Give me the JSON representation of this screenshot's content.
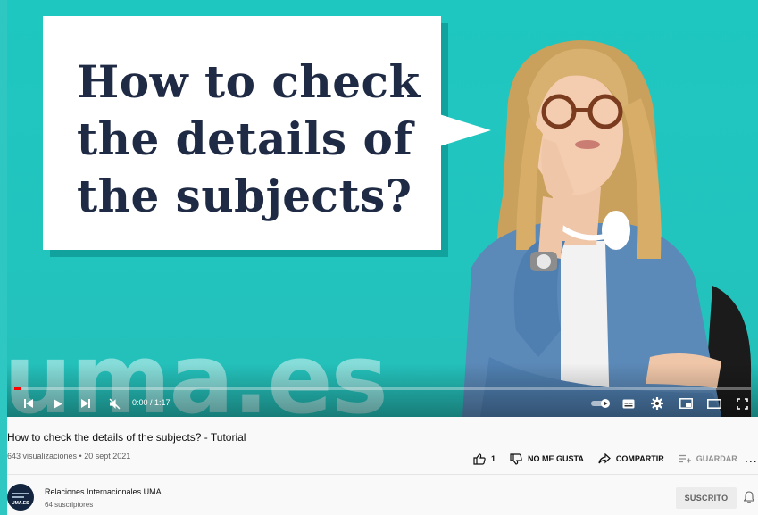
{
  "video": {
    "title_card_lines": [
      "How to check",
      "the details of",
      "the subjects?"
    ],
    "watermark": "uma.es",
    "time_display": "0:00 / 1:17",
    "progress_fraction": 0.01
  },
  "info": {
    "title": "How to check the details of the subjects? - Tutorial",
    "meta": "643 visualizaciones • 20 sept 2021",
    "like_count": "1",
    "dislike_label": "NO ME GUSTA",
    "share_label": "COMPARTIR",
    "save_label": "GUARDAR",
    "more_label": "..."
  },
  "channel": {
    "name": "Relaciones Internacionales UMA",
    "subscribers": "64 suscriptores",
    "avatar_text": "UMA.ES",
    "subscribe_label": "SUSCRITO"
  },
  "colors": {
    "accent": "#ff0000",
    "video_bg": "#21c6c0",
    "title_text": "#1f2a44"
  }
}
